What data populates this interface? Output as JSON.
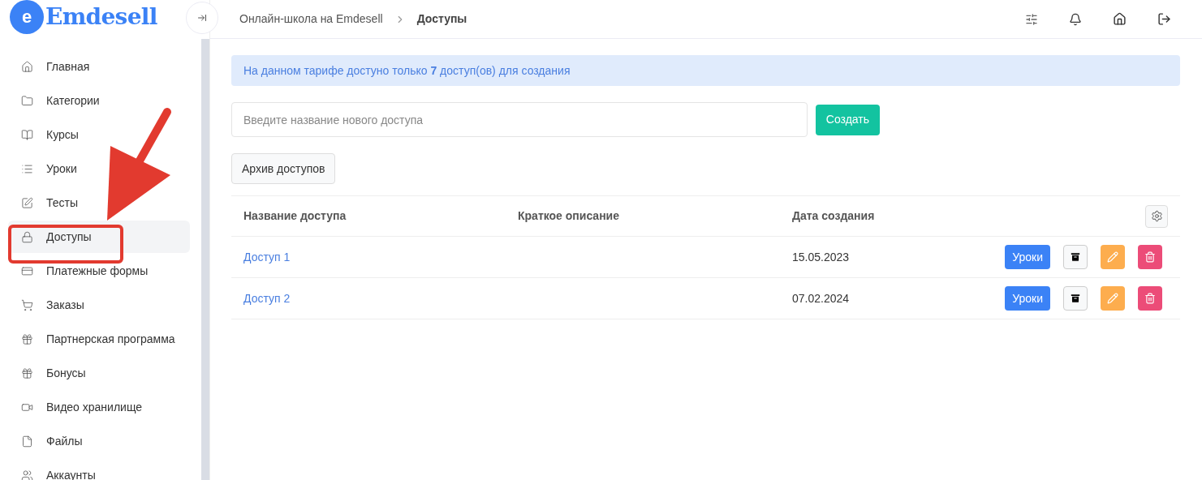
{
  "logo": {
    "letter": "e",
    "name": "Emdesell"
  },
  "sidebar": {
    "items": [
      {
        "label": "Главная",
        "selected": false
      },
      {
        "label": "Категории",
        "selected": false
      },
      {
        "label": "Курсы",
        "selected": false
      },
      {
        "label": "Уроки",
        "selected": false
      },
      {
        "label": "Тесты",
        "selected": false
      },
      {
        "label": "Доступы",
        "selected": true
      },
      {
        "label": "Платежные формы",
        "selected": false
      },
      {
        "label": "Заказы",
        "selected": false
      },
      {
        "label": "Партнерская программа",
        "selected": false
      },
      {
        "label": "Бонусы",
        "selected": false
      },
      {
        "label": "Видео хранилище",
        "selected": false
      },
      {
        "label": "Файлы",
        "selected": false
      },
      {
        "label": "Аккаунты",
        "selected": false
      }
    ]
  },
  "breadcrumbs": [
    {
      "label": "Онлайн-школа на Emdesell",
      "current": false
    },
    {
      "label": "Доступы",
      "current": true
    }
  ],
  "alert": "На данном тарифе достуно только **7** доступ(ов) для создания",
  "new_access": {
    "placeholder": "Введите название нового доступа",
    "button": "Создать"
  },
  "archive_button": "Архив доступов",
  "table": {
    "columns": [
      "Название доступа",
      "Краткое описание",
      "Дата создания"
    ],
    "rows": [
      {
        "name": "Доступ 1",
        "date": "15.05.2023",
        "lessons_button": "Уроки"
      },
      {
        "name": "Доступ 2",
        "date": "07.02.2024",
        "lessons_button": "Уроки"
      }
    ]
  }
}
